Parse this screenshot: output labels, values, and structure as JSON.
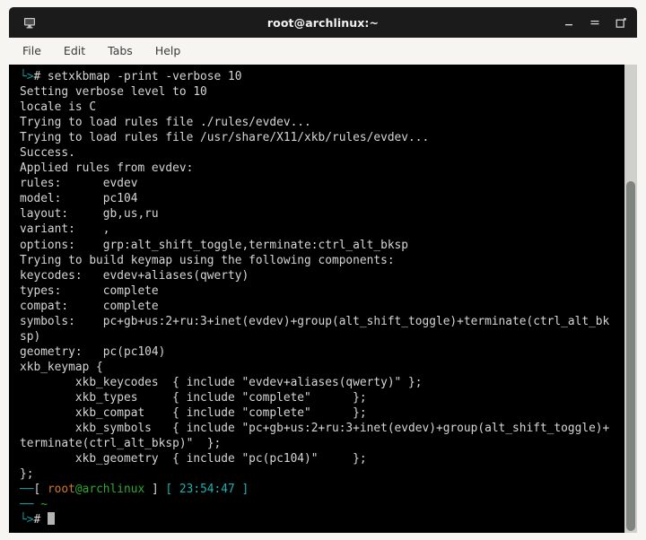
{
  "window": {
    "title": "root@archlinux:~",
    "icon": "terminal-monitor-icon",
    "controls": {
      "minimize": "_",
      "maximize": "≡",
      "close": "❐"
    }
  },
  "menubar": {
    "items": [
      {
        "label": "File"
      },
      {
        "label": "Edit"
      },
      {
        "label": "Tabs"
      },
      {
        "label": "Help"
      }
    ]
  },
  "terminal": {
    "command_prompt_prefix": "└>",
    "command_symbol": "#",
    "command": " setxkbmap -print -verbose 10",
    "output_lines": [
      "Setting verbose level to 10",
      "locale is C",
      "Trying to load rules file ./rules/evdev...",
      "Trying to load rules file /usr/share/X11/xkb/rules/evdev...",
      "Success.",
      "Applied rules from evdev:",
      "rules:      evdev",
      "model:      pc104",
      "layout:     gb,us,ru",
      "variant:    ,",
      "options:    grp:alt_shift_toggle,terminate:ctrl_alt_bksp",
      "Trying to build keymap using the following components:",
      "keycodes:   evdev+aliases(qwerty)",
      "types:      complete",
      "compat:     complete",
      "symbols:    pc+gb+us:2+ru:3+inet(evdev)+group(alt_shift_toggle)+terminate(ctrl_alt_bk",
      "sp)",
      "geometry:   pc(pc104)",
      "xkb_keymap {",
      "        xkb_keycodes  { include \"evdev+aliases(qwerty)\" };",
      "        xkb_types     { include \"complete\"      };",
      "        xkb_compat    { include \"complete\"      };",
      "        xkb_symbols   { include \"pc+gb+us:2+ru:3+inet(evdev)+group(alt_shift_toggle)+",
      "terminate(ctrl_alt_bksp)\"  };",
      "        xkb_geometry  { include \"pc(pc104)\"     };",
      "};"
    ],
    "prompt": {
      "line1_branch": "──",
      "bracket_open": "[",
      "user": "root",
      "host": "@archlinux",
      "bracket_close": "]",
      "time_bracket_open": "[",
      "time": "23:54:47",
      "time_bracket_close": "]",
      "line2_branch": "──",
      "cwd": "~",
      "line3_prefix": "└>",
      "line3_symbol": "#"
    }
  },
  "colors": {
    "background": "#000000",
    "foreground": "#d6d6d6",
    "titlebar": "#1b1b1b",
    "chrome": "#f6f5f1",
    "teal": "#139a9a",
    "cyan": "#19b2b2",
    "green": "#2fa82f",
    "orange": "#d1762a",
    "scroll_thumb": "#7f8481"
  }
}
